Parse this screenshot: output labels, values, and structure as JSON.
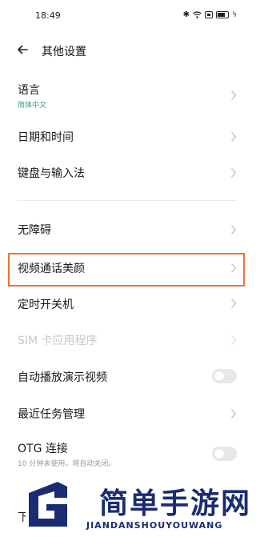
{
  "status_bar": {
    "time": "18:49",
    "icons": [
      "bluetooth-icon",
      "wifi-icon",
      "signal-box-icon",
      "battery-icon",
      "charging-icon"
    ]
  },
  "header": {
    "title": "其他设置"
  },
  "items": [
    {
      "label": "语言",
      "sub": "简体中文",
      "sub_color": "#27a86b"
    },
    {
      "label": "日期和时间"
    },
    {
      "label": "键盘与输入法"
    },
    {
      "label": "无障碍"
    },
    {
      "label": "视频通话美颜"
    },
    {
      "label": "定时开关机"
    },
    {
      "label": "SIM 卡应用程序",
      "disabled": true
    },
    {
      "label": "自动播放演示视频",
      "toggle": false
    },
    {
      "label": "最近任务管理"
    },
    {
      "label": "OTG 连接",
      "sub": "10 分钟未使用，将自动关闭。",
      "sub_color": "#999999",
      "toggle": false
    },
    {
      "label": "下载管"
    }
  ],
  "watermark": {
    "title": "简单手游网",
    "subtitle": "JIANDANSHOUYOUWANG"
  },
  "colors": {
    "accent_green": "#27a86b",
    "highlight_orange": "#e8743b",
    "brand_navy": "#1b2c73"
  }
}
